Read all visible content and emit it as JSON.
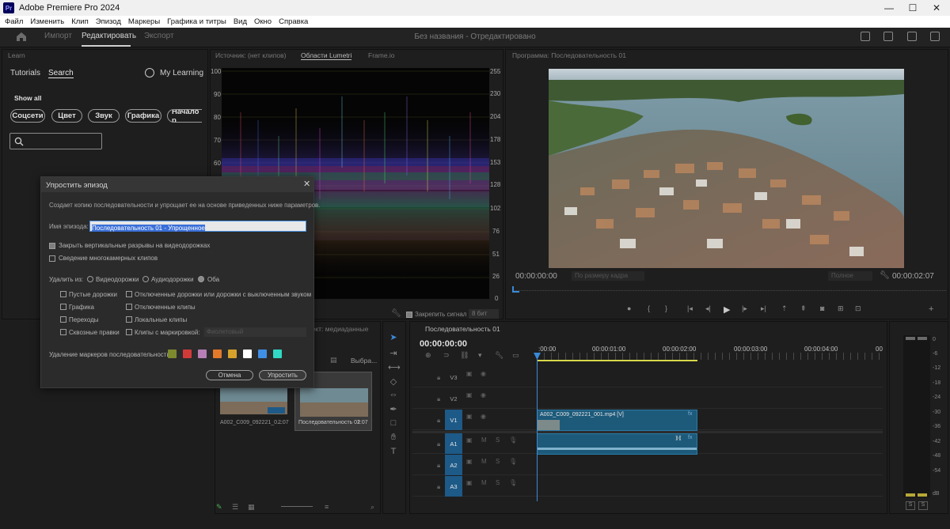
{
  "app": {
    "title": "Adobe Premiere Pro 2024",
    "logo": "Pr"
  },
  "window_controls": {
    "minimize": "—",
    "maximize": "☐",
    "close": "✕"
  },
  "menu": [
    "Файл",
    "Изменить",
    "Клип",
    "Эпизод",
    "Маркеры",
    "Графика и титры",
    "Вид",
    "Окно",
    "Справка"
  ],
  "mode_tabs": {
    "import": "Импорт",
    "edit": "Редактировать",
    "export": "Экспорт"
  },
  "project_title": "Без названия - Отредактировано",
  "learn": {
    "panel_title": "Learn",
    "tab_tutorials": "Tutorials",
    "tab_search": "Search",
    "my_learning": "My Learning",
    "show_all": "Show all",
    "chips": [
      "Соцсети",
      "Цвет",
      "Звук",
      "Графика",
      "Начало р"
    ]
  },
  "scope_panel": {
    "tabs": [
      "Источник: (нет клипов)",
      "Области Lumetri",
      "Frame.io"
    ],
    "left_axis": [
      "100",
      "90",
      "80",
      "70",
      "60"
    ],
    "right_axis": [
      "255",
      "230",
      "204",
      "178",
      "153",
      "128",
      "102",
      "76",
      "51",
      "26",
      "0"
    ],
    "clamp_label": "Закрепить сигнал",
    "bit_depth": "8 бит"
  },
  "program": {
    "title": "Программа: Последовательность 01",
    "timecode_in": "00:00:00:00",
    "fit": "По размеру кадра",
    "quality": "Полное",
    "timecode_out": "00:00:02:07"
  },
  "project_panel": {
    "title": "Проект: медиаданные",
    "selected_label": "Выбра...",
    "items": [
      {
        "name": "A002_C009_092221_0...",
        "duration": "2:07"
      },
      {
        "name": "Последовательность 01",
        "duration": "2:07"
      }
    ]
  },
  "timeline": {
    "title": "Последовательность 01",
    "timecode": "00:00:00:00",
    "ruler": [
      ":00:00",
      "00:00:01:00",
      "00:00:02:00",
      "00:00:03:00",
      "00:00:04:00",
      "00"
    ],
    "video_tracks": [
      "V3",
      "V2",
      "V1"
    ],
    "audio_tracks": [
      "A1",
      "A2",
      "A3"
    ],
    "track_mute": "M",
    "track_solo": "S",
    "clip_video_label": "A002_C009_092221_001.mp4 [V]",
    "fx_badge": "fx"
  },
  "meters": {
    "scale": [
      "0",
      "-6",
      "-12",
      "-18",
      "-24",
      "-30",
      "-36",
      "-42",
      "-48",
      "-54",
      "dB"
    ],
    "solo_left": "S",
    "solo_right": "S"
  },
  "dialog": {
    "title": "Упростить эпизод",
    "description": "Создает копию последовательности и упрощает ее на основе приведенных ниже параметров.",
    "name_label": "Имя эпизода:",
    "name_value": "Последовательность 01 - Упрощенное",
    "close_gaps": "Закрыть вертикальные разрывы на видеодорожках",
    "close_gaps_checked": true,
    "multicam": "Сведение многокамерных клипов",
    "multicam_checked": false,
    "remove_from": "Удалить из:",
    "radio_video": "Видеодорожки",
    "radio_audio": "Аудиодорожки",
    "radio_both": "Оба",
    "selected_radio": "Оба",
    "checks_left": [
      "Пустые дорожки",
      "Графика",
      "Переходы",
      "Сквозные правки"
    ],
    "checks_right": [
      "Отключенные дорожки или дорожки с выключенным звуком",
      "Отключенные клипы",
      "Локальные клипы",
      "Клипы с маркировкой:"
    ],
    "label_color": "Фиолетовый",
    "marker_label": "Удаление маркеров последовательности:",
    "marker_colors": [
      "#7d8a2e",
      "#d23a3a",
      "#b77fb5",
      "#e37a2a",
      "#d7a22b",
      "#ffffff",
      "#3f8fe6",
      "#31d9c4"
    ],
    "cancel": "Отмена",
    "ok": "Упростить"
  }
}
